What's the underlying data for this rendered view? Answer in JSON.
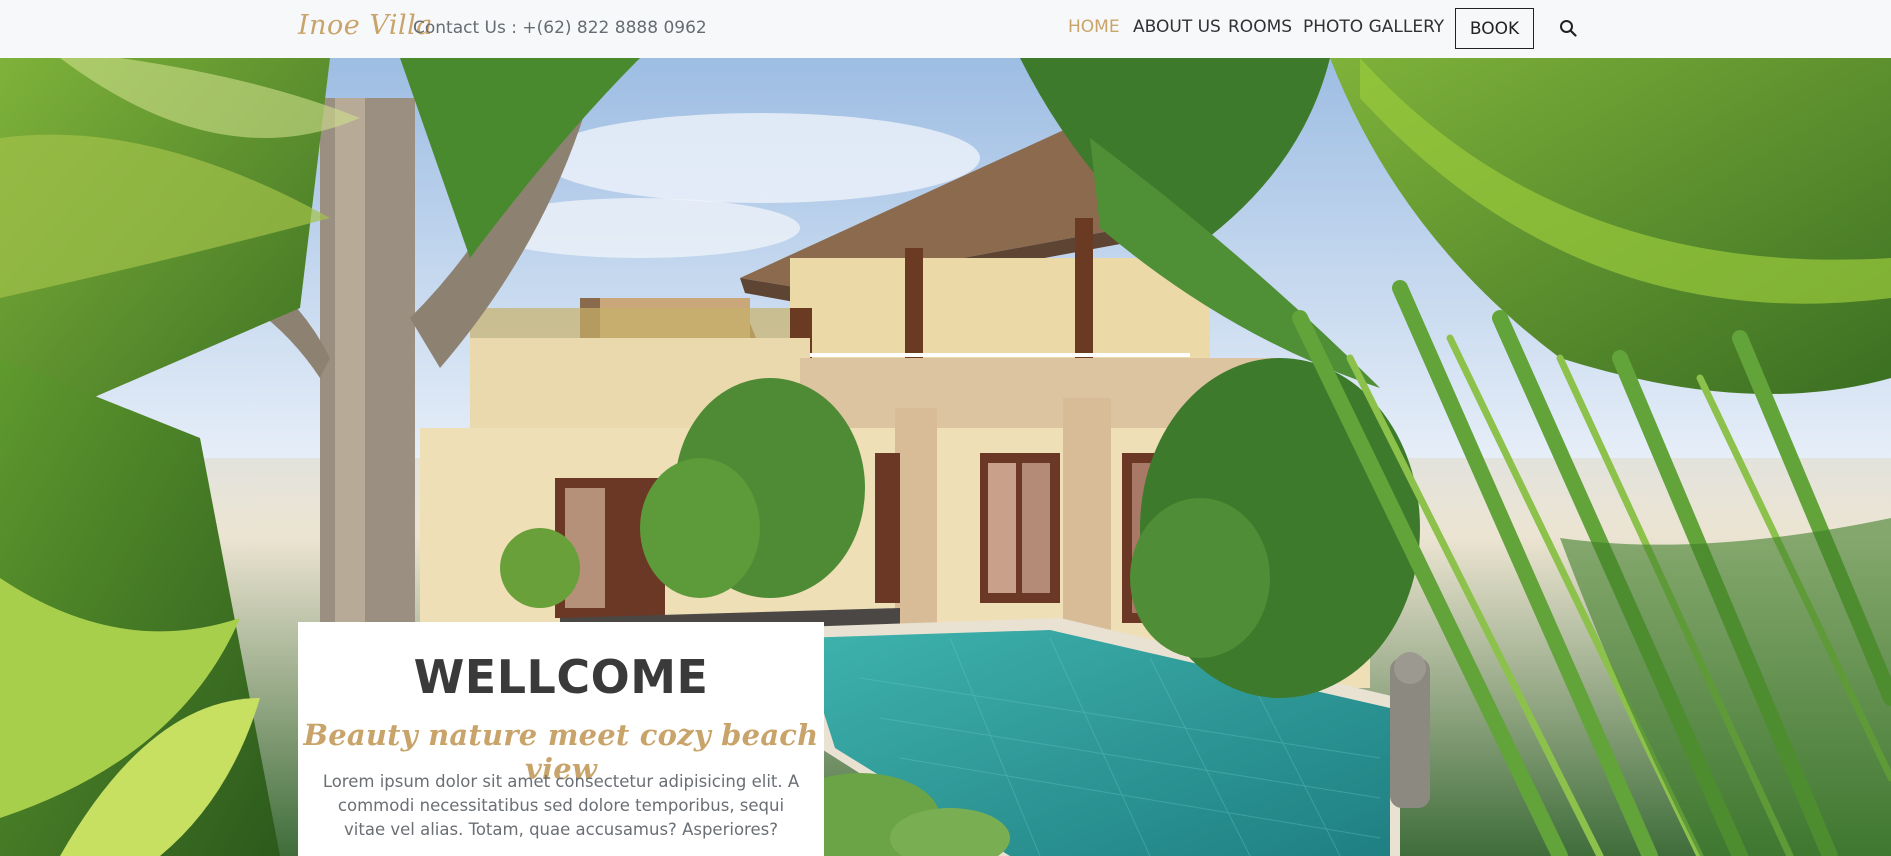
{
  "header": {
    "brand": "Inoe Villa",
    "contact": "Contact Us : +(62) 822 8888 0962",
    "nav": [
      {
        "label": "HOME",
        "active": true
      },
      {
        "label": "ABOUT US",
        "active": false
      },
      {
        "label": "ROOMS",
        "active": false
      },
      {
        "label": "PHOTO GALLERY",
        "active": false
      }
    ],
    "book_label": "BOOK",
    "search_icon": "search-icon"
  },
  "hero": {
    "image": "villa-pool-tropical-garden-photo"
  },
  "welcome": {
    "title": "WELLCOME",
    "subtitle": "Beauty nature meet cozy beach view",
    "text": "Lorem ipsum dolor sit amet consectetur adipisicing elit. A commodi necessitatibus sed dolore temporibus, sequi vitae vel alias. Totam, quae accusamus? Asperiores?"
  },
  "colors": {
    "accent": "#c9a46a",
    "nav_text": "#2f3235",
    "header_bg": "#f7f8fa"
  }
}
